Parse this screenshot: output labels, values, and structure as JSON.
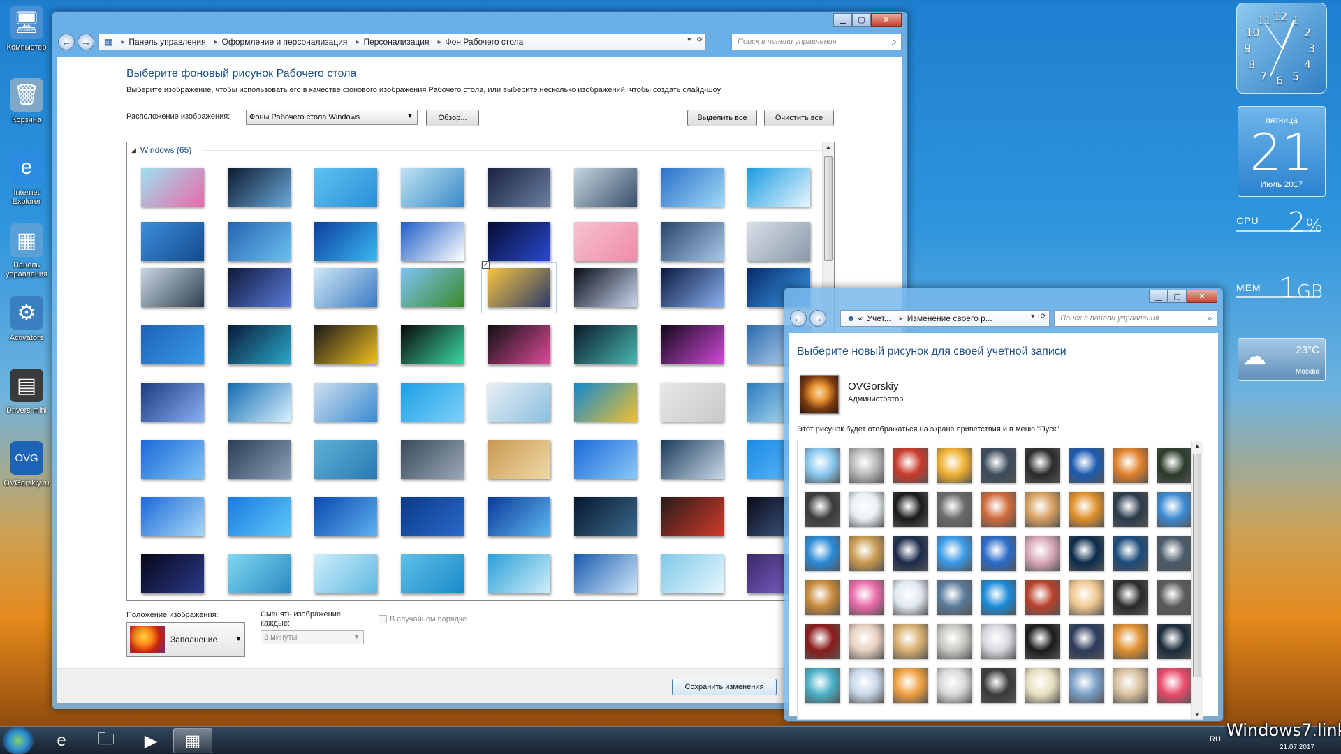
{
  "desktop": {
    "icons": [
      {
        "label": "Компьютер",
        "icon": "computer-icon",
        "glyph": "🖥",
        "color": "#4a8fd4"
      },
      {
        "label": "Корзина",
        "icon": "recycle-bin-icon",
        "glyph": "🗑",
        "color": "#7fa7c8"
      },
      {
        "label": "Internet Explorer",
        "icon": "internet-explorer-icon",
        "glyph": "e",
        "color": "#2b8be0"
      },
      {
        "label": "Панель управления",
        "icon": "control-panel-icon",
        "glyph": "▦",
        "color": "#5aa0d8"
      },
      {
        "label": "Activators",
        "icon": "activators-icon",
        "glyph": "⚙",
        "color": "#3a7fc0"
      },
      {
        "label": "Drivers mini",
        "icon": "drivers-icon",
        "glyph": "▤",
        "color": "#3a3a3a"
      },
      {
        "label": "OVGorskiy.ru",
        "icon": "ovgorskiy-icon",
        "glyph": "OVG",
        "color": "#1d64b8"
      }
    ]
  },
  "main_window": {
    "breadcrumb": [
      "Панель управления",
      "Оформление и персонализация",
      "Персонализация",
      "Фон Рабочего стола"
    ],
    "search_placeholder": "Поиск в панели управления",
    "heading": "Выберите фоновый рисунок Рабочего стола",
    "description": "Выберите изображение, чтобы использовать его в качестве фонового изображения Рабочего стола, или выберите несколько изображений, чтобы создать слайд-шоу.",
    "location_label": "Расположение изображения:",
    "location_value": "Фоны Рабочего стола Windows",
    "browse_button": "Обзор...",
    "select_all_button": "Выделить все",
    "clear_all_button": "Очистить все",
    "group_title": "Windows (65)",
    "position_label": "Положение изображения:",
    "position_value": "Заполнение",
    "change_label": "Сменять изображение каждые:",
    "interval_value": "3 минуты",
    "shuffle_label": "В случайном порядке",
    "save_button": "Сохранить изменения",
    "selected_index": 20
  },
  "account_window": {
    "breadcrumb": [
      "Учет...",
      "Изменение своего р..."
    ],
    "search_placeholder": "Поиск в панели управления",
    "heading": "Выберите новый рисунок для своей учетной записи",
    "user_name": "OVGorskiy",
    "user_role": "Администратор",
    "note": "Этот рисунок будет отображаться на экране приветствия и в меню \"Пуск\"."
  },
  "gadgets": {
    "clock_numbers": [
      "12",
      "1",
      "2",
      "3",
      "4",
      "5",
      "6",
      "7",
      "8",
      "9",
      "10",
      "11"
    ],
    "calendar_weekday": "пятница",
    "calendar_day": "21",
    "calendar_month_year": "Июль 2017",
    "cpu_label": "CPU",
    "cpu_value": "2",
    "cpu_unit": "%",
    "mem_label": "MEM",
    "mem_value": "1",
    "mem_unit": "GB",
    "weather_temp": "23°C",
    "weather_city": "Москва"
  },
  "taskbar": {
    "lang": "RU",
    "date": "21.07.2017"
  },
  "watermark": "Windows7.link"
}
